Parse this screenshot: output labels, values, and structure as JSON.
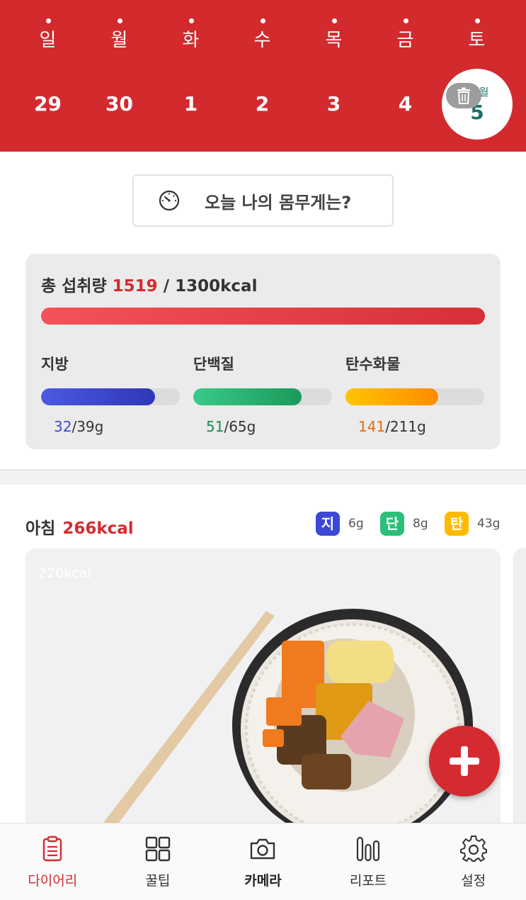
{
  "calendar": {
    "weekdays": [
      "일",
      "월",
      "화",
      "수",
      "목",
      "금",
      "토"
    ],
    "dates": [
      "29",
      "30",
      "1",
      "2",
      "3",
      "4"
    ],
    "selected": {
      "month": "10월",
      "day": "5"
    }
  },
  "weight_prompt": "오늘 나의 몸무게는?",
  "intake": {
    "label": "총 섭취량",
    "current": "1519",
    "target": " / 1300kcal",
    "progress": 1.0,
    "macros": [
      {
        "name": "지방",
        "current": "32",
        "target": "/39g",
        "progress": 0.82
      },
      {
        "name": "단백질",
        "current": "51",
        "target": "/65g",
        "progress": 0.78
      },
      {
        "name": "탄수화물",
        "current": "141",
        "target": "/211g",
        "progress": 0.67
      }
    ]
  },
  "meal": {
    "name": "아침",
    "kcal": "266kcal",
    "chips": [
      {
        "letter": "지",
        "grams": "6g",
        "color": "#3b49d6"
      },
      {
        "letter": "단",
        "grams": "8g",
        "color": "#2bbf78"
      },
      {
        "letter": "탄",
        "grams": "43g",
        "color": "#ffba00"
      }
    ],
    "photo_kcal": "220kcal"
  },
  "nav": [
    {
      "label": "다이어리",
      "icon": "clipboard-icon"
    },
    {
      "label": "꿀팁",
      "icon": "grid-icon"
    },
    {
      "label": "카메라",
      "icon": "camera-icon"
    },
    {
      "label": "리포트",
      "icon": "bar-chart-icon"
    },
    {
      "label": "설정",
      "icon": "gear-icon"
    }
  ],
  "colors": {
    "brand": "#d32a2e",
    "accent_text": "#d42b31"
  }
}
